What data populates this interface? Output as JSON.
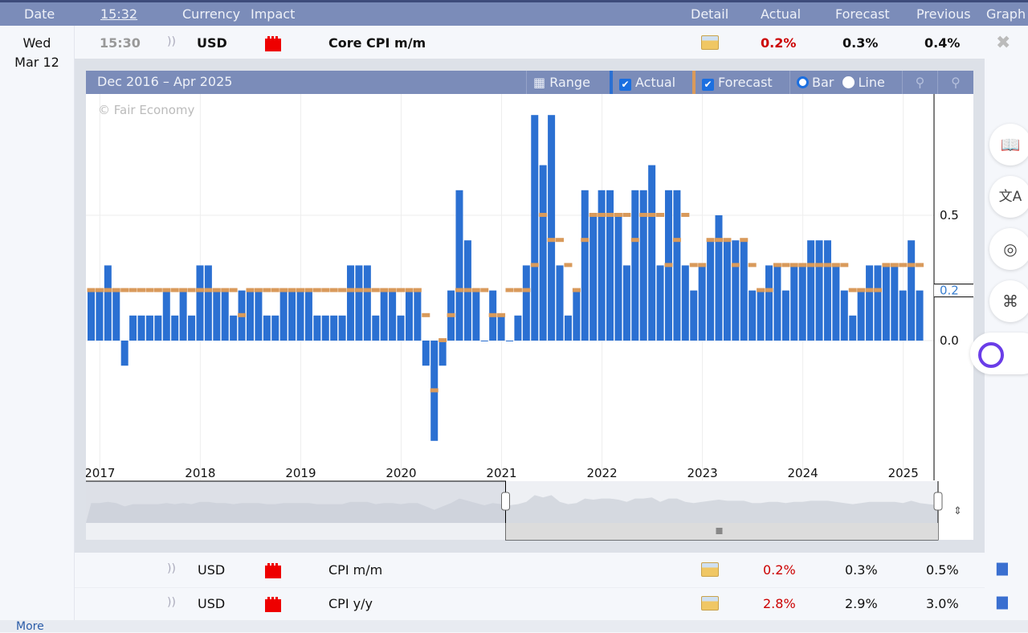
{
  "header": {
    "date": "Date",
    "time": "15:32",
    "currency": "Currency",
    "impact": "Impact",
    "detail": "Detail",
    "actual": "Actual",
    "forecast": "Forecast",
    "previous": "Previous",
    "graph": "Graph"
  },
  "day": {
    "weekday": "Wed",
    "date": "Mar 12"
  },
  "main_event": {
    "time": "15:30",
    "currency": "USD",
    "impact": "high",
    "title": "Core CPI m/m",
    "actual": "0.2%",
    "forecast": "0.3%",
    "previous": "0.4%"
  },
  "chart_toolbar": {
    "range_text": "Dec 2016 – Apr 2025",
    "range_button": "Range",
    "actual": "Actual",
    "forecast": "Forecast",
    "bar": "Bar",
    "line": "Line",
    "actual_checked": true,
    "forecast_checked": true,
    "selected_mode": "Bar"
  },
  "watermark": "© Fair Economy",
  "chart_data": {
    "type": "bar",
    "ylim": [
      -0.5,
      1.0
    ],
    "yticks": [
      "1.0",
      "0.5",
      "0.0"
    ],
    "current_value_label": "0.2",
    "xticks": [
      "2017",
      "2018",
      "2019",
      "2020",
      "2021",
      "2022",
      "2023",
      "2024",
      "2025"
    ],
    "start_month": "2016-11",
    "end_month": "2025-02",
    "series": [
      {
        "name": "Actual",
        "color": "#2b70d2",
        "values": [
          0.2,
          0.2,
          0.3,
          0.2,
          -0.1,
          0.1,
          0.1,
          0.1,
          0.1,
          0.2,
          0.1,
          0.2,
          0.1,
          0.3,
          0.3,
          0.2,
          0.2,
          0.1,
          0.2,
          0.2,
          0.2,
          0.1,
          0.1,
          0.2,
          0.2,
          0.2,
          0.2,
          0.1,
          0.1,
          0.1,
          0.1,
          0.3,
          0.3,
          0.3,
          0.1,
          0.2,
          0.2,
          0.1,
          0.2,
          0.2,
          -0.1,
          -0.4,
          -0.1,
          0.2,
          0.6,
          0.4,
          0.2,
          0.0,
          0.2,
          0.1,
          0.0,
          0.1,
          0.3,
          0.9,
          0.7,
          0.9,
          0.3,
          0.1,
          0.2,
          0.6,
          0.5,
          0.6,
          0.6,
          0.5,
          0.3,
          0.6,
          0.6,
          0.7,
          0.3,
          0.6,
          0.6,
          0.3,
          0.2,
          0.3,
          0.4,
          0.5,
          0.4,
          0.4,
          0.4,
          0.2,
          0.2,
          0.3,
          0.3,
          0.2,
          0.3,
          0.3,
          0.4,
          0.4,
          0.4,
          0.3,
          0.2,
          0.1,
          0.2,
          0.3,
          0.3,
          0.3,
          0.3,
          0.2,
          0.4,
          0.2
        ]
      },
      {
        "name": "Forecast",
        "color": "#d99a5b",
        "values": [
          0.2,
          0.2,
          0.2,
          0.2,
          0.2,
          0.2,
          0.2,
          0.2,
          0.2,
          0.2,
          0.2,
          0.2,
          0.2,
          0.2,
          0.2,
          0.2,
          0.2,
          0.2,
          0.1,
          0.2,
          0.2,
          0.2,
          0.2,
          0.2,
          0.2,
          0.2,
          0.2,
          0.2,
          0.2,
          0.2,
          0.2,
          0.2,
          0.2,
          0.2,
          0.2,
          0.2,
          0.2,
          0.2,
          0.2,
          0.2,
          0.1,
          -0.2,
          0.0,
          0.1,
          0.2,
          0.2,
          0.2,
          0.2,
          0.1,
          0.1,
          0.2,
          0.2,
          0.2,
          0.3,
          0.5,
          0.4,
          0.4,
          0.3,
          0.2,
          0.4,
          0.5,
          0.5,
          0.5,
          0.5,
          0.5,
          0.4,
          0.5,
          0.5,
          0.5,
          0.3,
          0.4,
          0.5,
          0.3,
          0.3,
          0.4,
          0.4,
          0.4,
          0.3,
          0.4,
          0.3,
          0.2,
          0.2,
          0.3,
          0.3,
          0.3,
          0.3,
          0.3,
          0.3,
          0.3,
          0.3,
          0.3,
          0.2,
          0.2,
          0.2,
          0.2,
          0.3,
          0.3,
          0.3,
          0.3,
          0.3
        ]
      }
    ],
    "navigator_selection": [
      "2021",
      "2025"
    ]
  },
  "other_events": [
    {
      "currency": "USD",
      "impact": "high",
      "title": "CPI m/m",
      "actual": "0.2%",
      "forecast": "0.3%",
      "previous": "0.5%"
    },
    {
      "currency": "USD",
      "impact": "high",
      "title": "CPI y/y",
      "actual": "2.8%",
      "forecast": "2.9%",
      "previous": "3.0%"
    }
  ],
  "colors": {
    "header": "#7b8cb9",
    "actual_better": "#cc0000",
    "bar": "#2b70d2",
    "forecast_marker": "#d99a5b"
  },
  "more_link": "More"
}
